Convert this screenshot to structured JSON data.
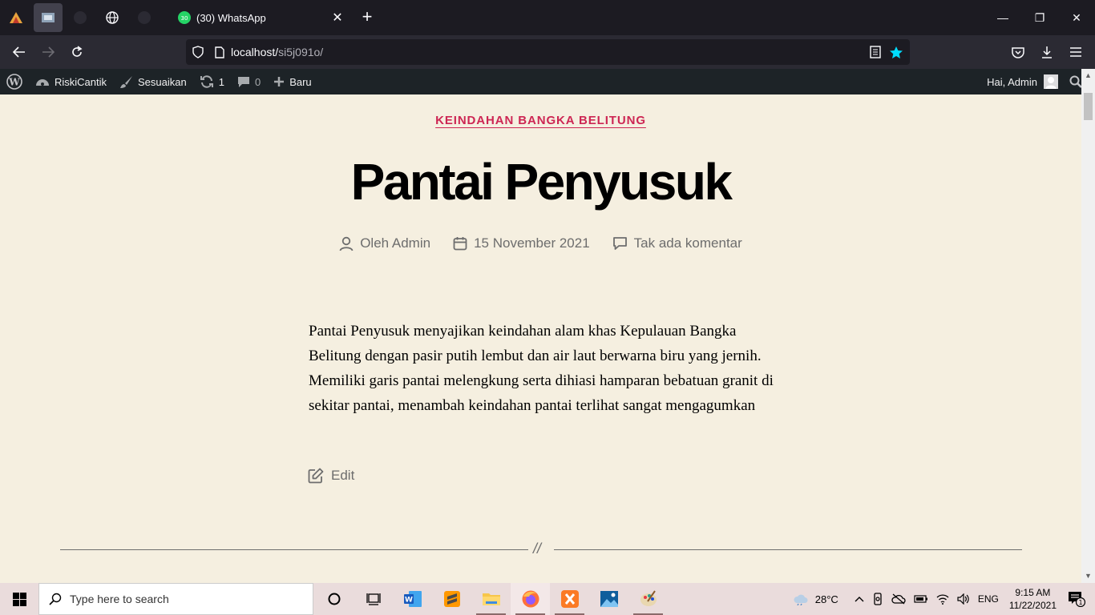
{
  "browser": {
    "tab": {
      "title": "(30) WhatsApp",
      "badge": "30"
    },
    "url": {
      "host": "localhost/",
      "path": "si5j091o/"
    }
  },
  "wpbar": {
    "site_name": "RiskiCantik",
    "customize": "Sesuaikan",
    "updates_count": "1",
    "comments_count": "0",
    "new_label": "Baru",
    "greeting": "Hai, Admin"
  },
  "post": {
    "category": "KEINDAHAN BANGKA BELITUNG",
    "title": "Pantai Penyusuk",
    "author": "Oleh Admin",
    "date": "15 November 2021",
    "comments": "Tak ada komentar",
    "body": "Pantai Penyusuk menyajikan keindahan alam khas Kepulauan Bangka Belitung dengan pasir putih lembut dan air laut berwarna biru yang jernih. Memiliki garis pantai melengkung serta dihiasi hamparan bebatuan granit di sekitar pantai, menambah keindahan pantai terlihat sangat mengagumkan",
    "edit_label": "Edit",
    "separator": "//"
  },
  "taskbar": {
    "search_placeholder": "Type here to search",
    "weather": "28°C",
    "lang": "ENG",
    "time": "9:15 AM",
    "date": "11/22/2021",
    "notification_count": "1"
  },
  "colors": {
    "accent": "#cd2653",
    "page_bg": "#f5efe0",
    "wpbar_bg": "#1d2327",
    "browser_bg": "#1c1b22"
  }
}
